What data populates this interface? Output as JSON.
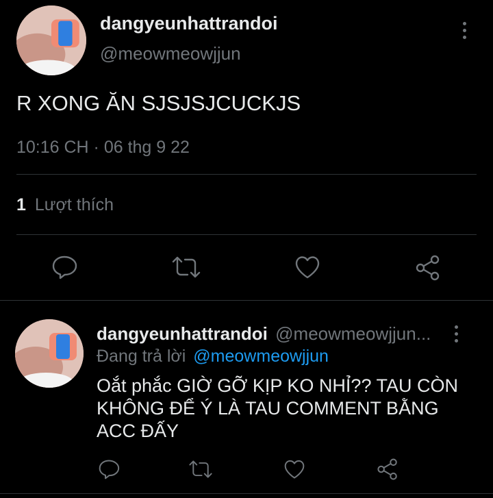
{
  "main_tweet": {
    "display_name": "dangyeunhattrandoi",
    "handle": "@meowmeowjjun",
    "text": "R XONG ĂN SJSJSJCUCKJS",
    "timestamp": "10:16 CH · 06 thg 9 22",
    "likes_count": "1",
    "likes_label": "Lượt thích"
  },
  "reply_tweet": {
    "display_name": "dangyeunhattrandoi",
    "handle": "@meowmeowjjun...",
    "replying_to_label": "Đang trả lời",
    "replying_to_handle": "@meowmeowjjun",
    "text_lines": [
      "Oắt phắc GIỜ GỠ KỊP KO NHỈ?? TAU CÒN",
      "KHÔNG ĐỂ Ý LÀ TAU COMMENT BẰNG",
      "ACC ĐẤY"
    ]
  },
  "icons": {
    "reply": "reply-icon",
    "retweet": "retweet-icon",
    "like": "heart-icon",
    "share": "share-icon",
    "more": "more-options-icon"
  },
  "colors": {
    "background": "#000000",
    "text": "#e7e9ea",
    "muted": "#71767b",
    "link": "#1d9bf0",
    "divider": "#2f3336"
  }
}
